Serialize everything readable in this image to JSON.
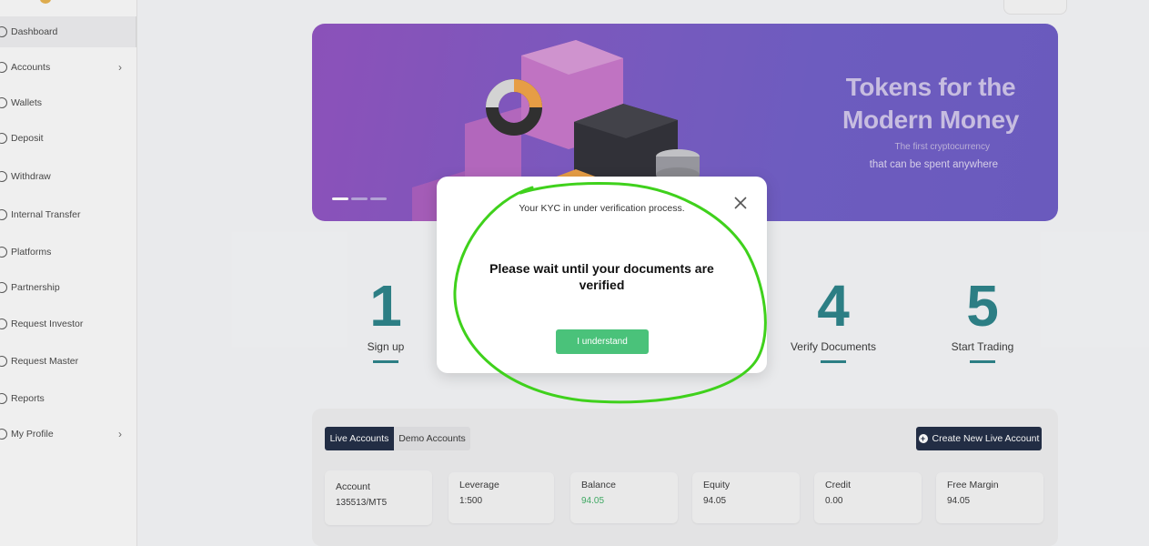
{
  "sidebar": {
    "items": [
      {
        "label": "Dashboard",
        "icon": "dashboard-icon",
        "active": true
      },
      {
        "label": "Accounts",
        "icon": "user-icon",
        "has_submenu": true
      },
      {
        "label": "Wallets",
        "icon": "wallet-icon"
      },
      {
        "label": "Deposit",
        "icon": "deposit-icon"
      },
      {
        "label": "Withdraw",
        "icon": "withdraw-icon"
      },
      {
        "label": "Internal Transfer",
        "icon": "transfer-icon"
      },
      {
        "label": "Platforms",
        "icon": "platforms-icon"
      },
      {
        "label": "Partnership",
        "icon": "partnership-icon"
      },
      {
        "label": "Request Investor",
        "icon": "investor-icon"
      },
      {
        "label": "Request Master",
        "icon": "master-icon"
      },
      {
        "label": "Reports",
        "icon": "reports-icon"
      },
      {
        "label": "My Profile",
        "icon": "profile-icon",
        "has_submenu": true
      }
    ]
  },
  "banner": {
    "title_line1": "Tokens for the",
    "title_line2": "Modern Money",
    "subtitle1": "The first cryptocurrency",
    "subtitle2": "that can be spent anywhere"
  },
  "steps": [
    {
      "number": "1",
      "label": "Sign up"
    },
    {
      "number": "4",
      "label": "Verify Documents"
    },
    {
      "number": "5",
      "label": "Start Trading"
    }
  ],
  "accounts": {
    "tabs": {
      "live": "Live Accounts",
      "demo": "Demo Accounts"
    },
    "create_button": "Create New Live Account",
    "cards": [
      {
        "label": "Account",
        "value": "135513/MT5"
      },
      {
        "label": "Leverage",
        "value": "1:500"
      },
      {
        "label": "Balance",
        "value": "94.05"
      },
      {
        "label": "Equity",
        "value": "94.05"
      },
      {
        "label": "Credit",
        "value": "0.00"
      },
      {
        "label": "Free Margin",
        "value": "94.05"
      }
    ]
  },
  "modal": {
    "message": "Your KYC in under verification process.",
    "heading": "Please wait until your documents are verified",
    "button": "I understand",
    "close_icon": "close-icon"
  },
  "colors": {
    "accent_teal": "#267f86",
    "button_green": "#4ac27a",
    "navy": "#1c2840",
    "annotation_green": "#3fd11c",
    "balance_green": "#3cae62"
  }
}
